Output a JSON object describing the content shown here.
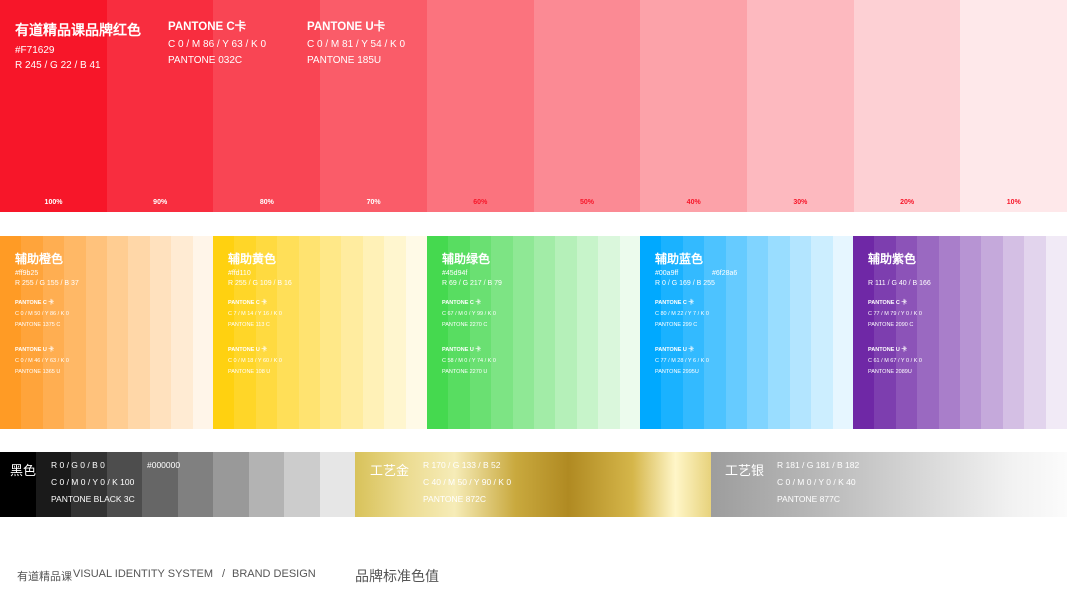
{
  "brand_red": {
    "title": "有道精品课品牌红色",
    "hex": "#F71629",
    "rgb": "R 245  /  G 22  /  B 41",
    "pantone_c_title": "PANTONE C卡",
    "pantone_c_values": "C 0  /  M 86  /  Y 63  /  K 0",
    "pantone_c_code": "PANTONE 032C",
    "pantone_u_title": "PANTONE U卡",
    "pantone_u_values": "C 0  /  M 81  /  Y 54  /  K 0",
    "pantone_u_code": "PANTONE 185U",
    "tints": [
      {
        "label": "100%",
        "color": "#F71629"
      },
      {
        "label": "90%",
        "color": "#F82D3F"
      },
      {
        "label": "80%",
        "color": "#F94554"
      },
      {
        "label": "70%",
        "color": "#FA5C69"
      },
      {
        "label": "60%",
        "color": "#FB737E"
      },
      {
        "label": "50%",
        "color": "#FB8A94"
      },
      {
        "label": "40%",
        "color": "#FCA2A9"
      },
      {
        "label": "30%",
        "color": "#FDB9BF"
      },
      {
        "label": "20%",
        "color": "#FDD0D4"
      },
      {
        "label": "10%",
        "color": "#FEE8EA"
      }
    ]
  },
  "aux_palettes": [
    {
      "title": "辅助橙色",
      "hex": "#ff9b25",
      "hex2": "",
      "rgb": "R 255  /  G 155  /  B 37",
      "c_title": "PANTONE C 卡",
      "c_values": "C 0  /  M 50  /  Y 86  /  K 0",
      "c_code": "PANTONE 1375 C",
      "u_title": "PANTONE U 卡",
      "u_values": "C 0  /  M 46  /  Y 63  /  K 0",
      "u_code": "PANTONE 1365 U",
      "tints": [
        "#FF9B25",
        "#FFA43B",
        "#FFAE51",
        "#FFB866",
        "#FFC27C",
        "#FFCD92",
        "#FFD7A8",
        "#FFE1BE",
        "#FFEBD3",
        "#FFF5E9"
      ]
    },
    {
      "title": "辅助黄色",
      "hex": "#ffd110",
      "hex2": "",
      "rgb": "R 255  /  G 109  /  B 16",
      "c_title": "PANTONE C 卡",
      "c_values": "C 7  /  M 14  /  Y 16  /  K 0",
      "c_code": "PANTONE 113 C",
      "u_title": "PANTONE U 卡",
      "u_values": "C 0  /  M 18  /  Y 60  /  K 0",
      "u_code": "PANTONE 108 U",
      "tints": [
        "#FFD110",
        "#FFD628",
        "#FFDA40",
        "#FFDF58",
        "#FFE370",
        "#FFE888",
        "#FFEC9F",
        "#FFF1B7",
        "#FFF6CF",
        "#FFFAE7"
      ]
    },
    {
      "title": "辅助绿色",
      "hex": "#45d94f",
      "hex2": "",
      "rgb": "R 69  /  G 217  /  B 79",
      "c_title": "PANTONE C 卡",
      "c_values": "C 67  /  M 0  /  Y 99  /  K 0",
      "c_code": "PANTONE 2270 C",
      "u_title": "PANTONE U 卡",
      "u_values": "C 58  /  M 0  /  Y 74  /  K 0",
      "u_code": "PANTONE 2270 U",
      "tints": [
        "#45D94F",
        "#58DD61",
        "#6AE072",
        "#7DE484",
        "#8FE895",
        "#A2ECA7",
        "#B5F0B9",
        "#C7F4CA",
        "#DAF7DC",
        "#ECFBED"
      ]
    },
    {
      "title": "辅助蓝色",
      "hex": "#00a9ff",
      "hex2": "#6f28a6",
      "rgb": "R 0  /  G 169  /  B 255",
      "c_title": "PANTONE C 卡",
      "c_values": "C 80  /  M 22  /  Y 7  /  K 0",
      "c_code": "PANTONE 299 C",
      "u_title": "PANTONE U 卡",
      "u_values": "C 77  /  M 28  /  Y 6  /  K 0",
      "u_code": "PANTONE 2995U",
      "tints": [
        "#00A9FF",
        "#1AB2FF",
        "#33BAFF",
        "#4DC3FF",
        "#66CBFF",
        "#80D4FF",
        "#99DDFF",
        "#B3E5FF",
        "#CCEEFF",
        "#E6F6FF"
      ]
    },
    {
      "title": "辅助紫色",
      "hex": "",
      "hex2": "",
      "rgb": "R 111  /  G 40  /  B 166",
      "c_title": "PANTONE C 卡",
      "c_values": "C 77  /  M 79  /  Y 0  /  K 0",
      "c_code": "PANTONE 2090 C",
      "u_title": "PANTONE U 卡",
      "u_values": "C 61  /  M 67  /  Y 0  /  K 0",
      "u_code": "PANTONE 2089U",
      "tints": [
        "#6F28A6",
        "#7D3EAF",
        "#8C53B8",
        "#9A69C1",
        "#A97ECA",
        "#B794D3",
        "#C5A9DB",
        "#D4BFE4",
        "#E2D4ED",
        "#F1EAF6"
      ]
    }
  ],
  "black": {
    "title": "黑色",
    "rgb": "R 0  /  G 0  /  B 0",
    "hex": "#000000",
    "cmyk": "C 0  /  M 0  /  Y 0  /  K 100",
    "pantone": "PANTONE BLACK 3C",
    "tints": [
      "#000000",
      "#1A1A1A",
      "#333333",
      "#4D4D4D",
      "#666666",
      "#808080",
      "#999999",
      "#B3B3B3",
      "#CCCCCC",
      "#E6E6E6"
    ]
  },
  "gold": {
    "title": "工艺金",
    "rgb": "R 170  /  G 133  /  B 52",
    "cmyk": "C 40  /  M 50  /  Y 90  /  K 0",
    "pantone": "PANTONE 872C"
  },
  "silver": {
    "title": "工艺银",
    "rgb": "R 181  /  G 181  /  B 182",
    "cmyk": "C 0  /  M 0  /  Y 0  /  K 40",
    "pantone": "PANTONE 877C"
  },
  "footer": {
    "brand": "有道精品课",
    "system": "VISUAL IDENTITY SYSTEM",
    "sep": "/",
    "design": "BRAND DESIGN",
    "section": "品牌标准色值"
  }
}
